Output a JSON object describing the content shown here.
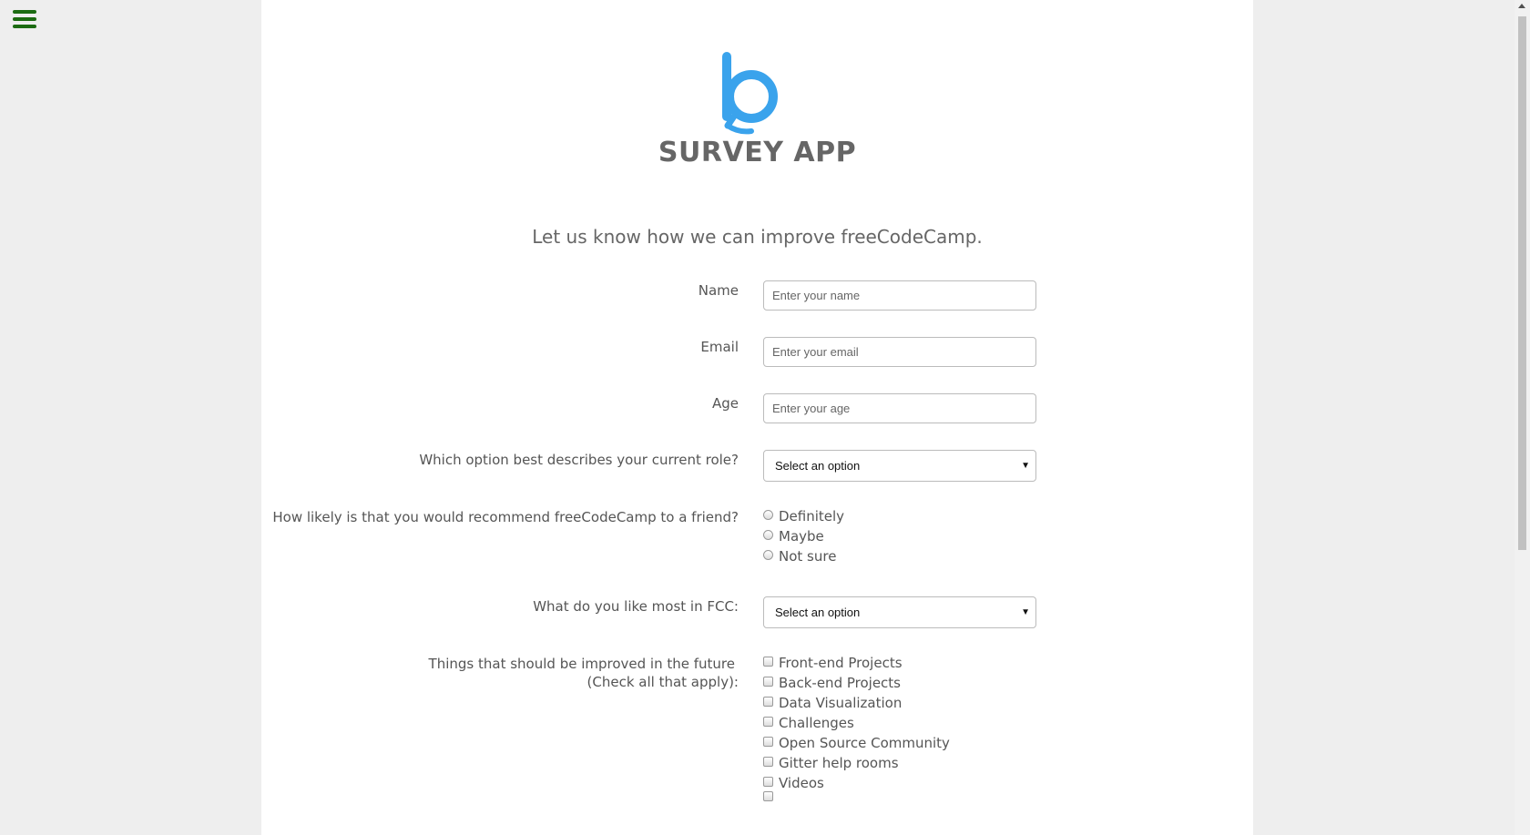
{
  "app": {
    "title": "SURVEY APP",
    "subtitle": "Let us know how we can improve freeCodeCamp.",
    "brand_color": "#3aa3ec",
    "menu_color": "#1c6b12"
  },
  "form": {
    "name": {
      "label": "Name",
      "placeholder": "Enter your name"
    },
    "email": {
      "label": "Email",
      "placeholder": "Enter your email"
    },
    "age": {
      "label": "Age",
      "placeholder": "Enter your age"
    },
    "role": {
      "label": "Which option best describes your current role?",
      "selected": "Select an option"
    },
    "recommend": {
      "label": "How likely is that you would recommend freeCodeCamp to a friend?",
      "options": [
        "Definitely",
        "Maybe",
        "Not sure"
      ]
    },
    "like_most": {
      "label": "What do you like most in FCC:",
      "selected": "Select an option"
    },
    "improve": {
      "label_line1": "Things that should be improved in the future",
      "label_line2": "(Check all that apply):",
      "options": [
        "Front-end Projects",
        "Back-end Projects",
        "Data Visualization",
        "Challenges",
        "Open Source Community",
        "Gitter help rooms",
        "Videos"
      ]
    }
  }
}
